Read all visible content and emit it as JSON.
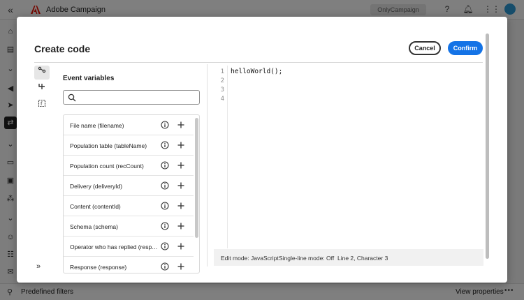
{
  "app": {
    "title": "Adobe Campaign",
    "org": "OnlyCampaign",
    "collapse_glyph": "«",
    "icons": [
      "help-icon",
      "bell-icon",
      "apps-grid-icon",
      "avatar"
    ],
    "rail_icons": [
      "home-icon",
      "explorer-icon",
      "chevron-down-icon",
      "campaign-icon",
      "delivery-icon",
      "workflow-icon",
      "chevron-down-icon",
      "audiences-icon",
      "content-icon",
      "data-icon",
      "chevron-down-icon",
      "profiles-icon",
      "audience-users-icon",
      "inbox-icon",
      "reports-icon"
    ]
  },
  "bottom_bar": {
    "predefined_filters": "Predefined filters",
    "view_properties": "View properties",
    "more": "•••"
  },
  "dialog": {
    "title": "Create code",
    "cancel_label": "Cancel",
    "confirm_label": "Confirm",
    "tools": [
      "variables-tool",
      "conditions-tool",
      "functions-tool"
    ],
    "expand_glyph": "»",
    "variables": {
      "heading": "Event variables",
      "search_placeholder": "",
      "items": [
        {
          "label": "File name (filename)"
        },
        {
          "label": "Population table (tableName)"
        },
        {
          "label": "Population count (recCount)"
        },
        {
          "label": "Delivery (deliveryId)"
        },
        {
          "label": "Content (contentId)"
        },
        {
          "label": "Schema (schema)"
        },
        {
          "label": "Operator who has replied (respo..."
        },
        {
          "label": "Response (response)"
        }
      ]
    },
    "editor": {
      "line_numbers": [
        "1",
        "2",
        "3",
        "4"
      ],
      "lines": [
        "helloWorld();",
        "",
        "",
        ""
      ],
      "status": {
        "edit_mode": "Edit mode: JavaScript",
        "single_line": "Single-line mode: Off",
        "position": "Line 2, Character 3"
      }
    }
  },
  "colors": {
    "accent": "#1473e6",
    "brand": "#eb1000",
    "overlay": "rgba(0,0,0,0.5)"
  }
}
